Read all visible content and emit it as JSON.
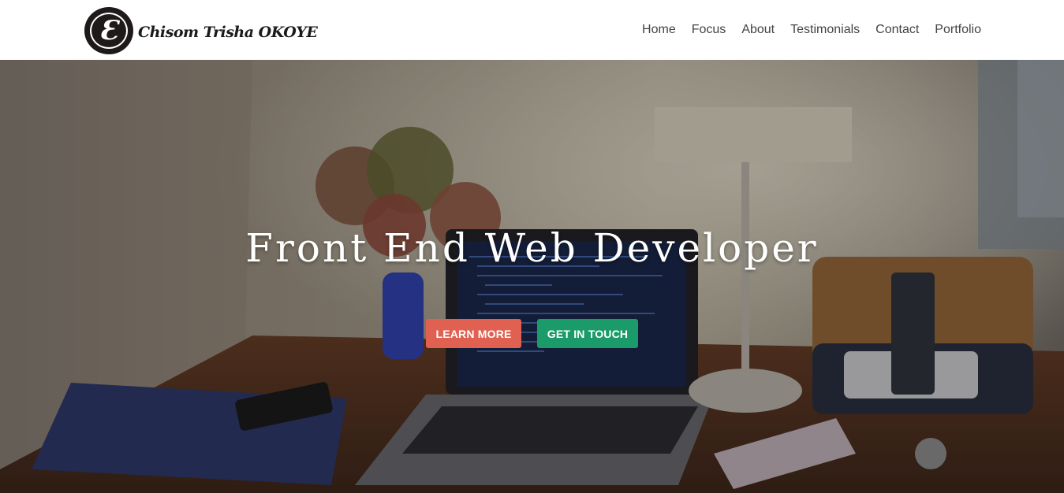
{
  "brand": {
    "logo_letter": "Ɛ",
    "name": "Chisom Trisha OKOYE"
  },
  "nav": {
    "items": [
      "Home",
      "Focus",
      "About",
      "Testimonials",
      "Contact",
      "Portfolio"
    ]
  },
  "hero": {
    "title": "Front End Web Developer",
    "learn_more_label": "LEARN MORE",
    "get_in_touch_label": "GET IN TOUCH"
  },
  "colors": {
    "learn_more": "#e06152",
    "get_in_touch": "#1a9b69",
    "logo": "#1e1a1a"
  }
}
